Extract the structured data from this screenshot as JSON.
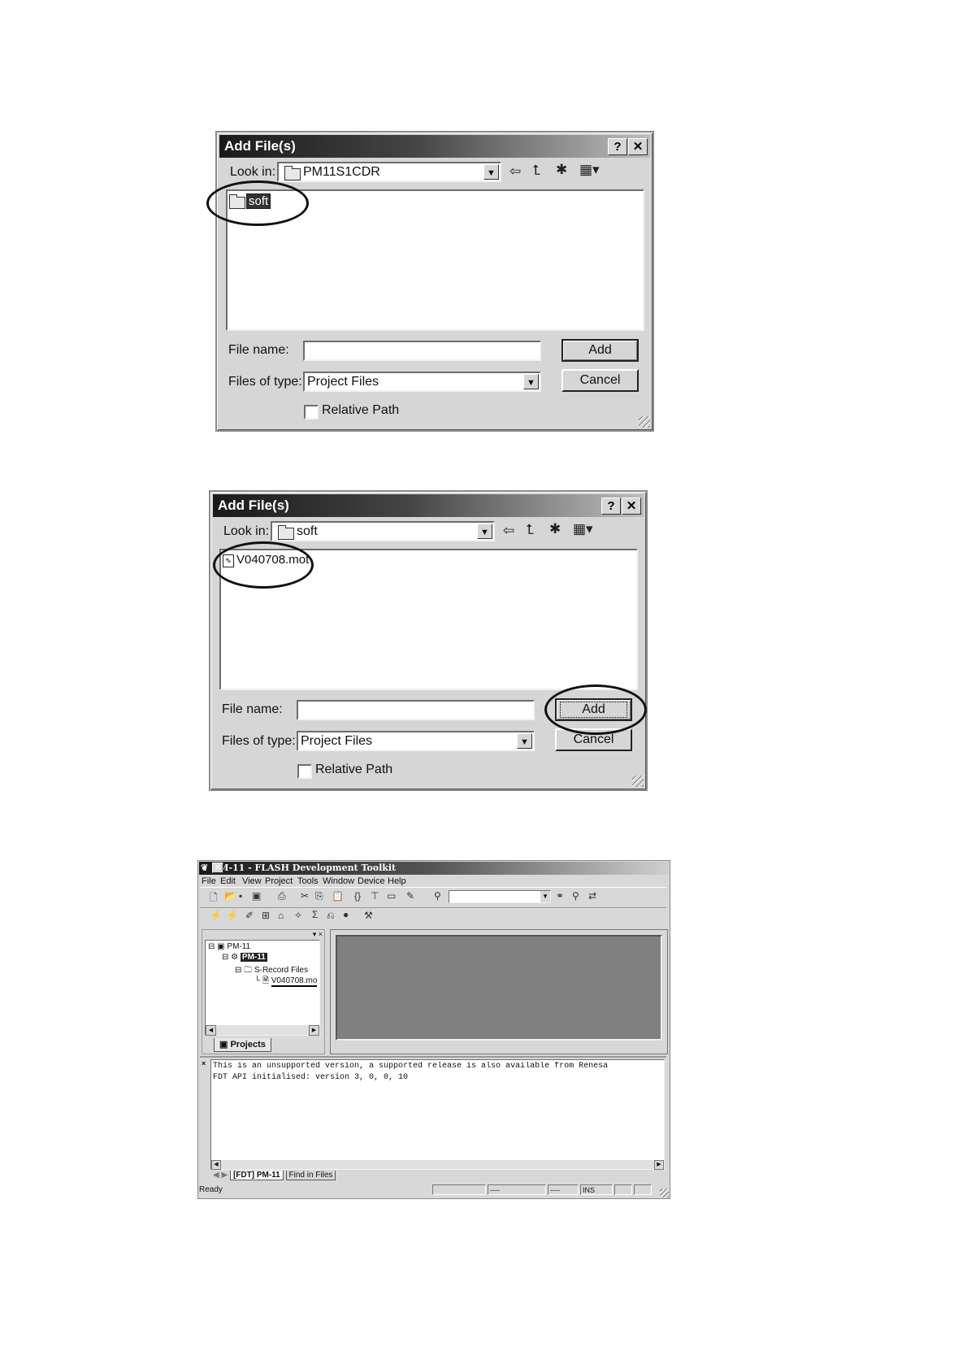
{
  "dialog1": {
    "title": "Add File(s)",
    "help_btn": "?",
    "close_btn": "✕",
    "look_in_label": "Look in:",
    "look_in_value": "PM11S1CDR",
    "file_list": [
      {
        "name": "soft",
        "icon": "folder-icon"
      }
    ],
    "file_name_label": "File name:",
    "file_name_value": "",
    "files_of_type_label": "Files of type:",
    "files_of_type_value": "Project Files",
    "add_label": "Add",
    "cancel_label": "Cancel",
    "relative_path_label": "Relative Path",
    "relative_path_checked": false
  },
  "dialog2": {
    "title": "Add File(s)",
    "help_btn": "?",
    "close_btn": "✕",
    "look_in_label": "Look in:",
    "look_in_value": "soft",
    "file_list": [
      {
        "name": "V040708.mot",
        "icon": "mot-file-icon"
      }
    ],
    "file_name_label": "File name:",
    "file_name_value": "",
    "files_of_type_label": "Files of type:",
    "files_of_type_value": "Project Files",
    "add_label": "Add",
    "cancel_label": "Cancel",
    "relative_path_label": "Relative Path",
    "relative_path_checked": false
  },
  "fdt": {
    "title": "PM-11 - FLASH Development Toolkit",
    "menu": [
      "File",
      "Edit",
      "View",
      "Project",
      "Tools",
      "Window",
      "Device",
      "Help"
    ],
    "tree": {
      "workspace": "PM-11",
      "project": "PM-11",
      "folder": "S-Record Files",
      "file": "V040708.mo"
    },
    "projects_tab": "Projects",
    "output_lines": [
      "This is an unsupported version, a supported release is also available from Renesa",
      "FDT API initialised: version 3, 0, 0, 10"
    ],
    "output_tabs": [
      "[FDT] PM-11",
      "Find in Files"
    ],
    "status": {
      "ready": "Ready",
      "pane2": "----",
      "pane3": "----",
      "ins": "INS"
    }
  }
}
